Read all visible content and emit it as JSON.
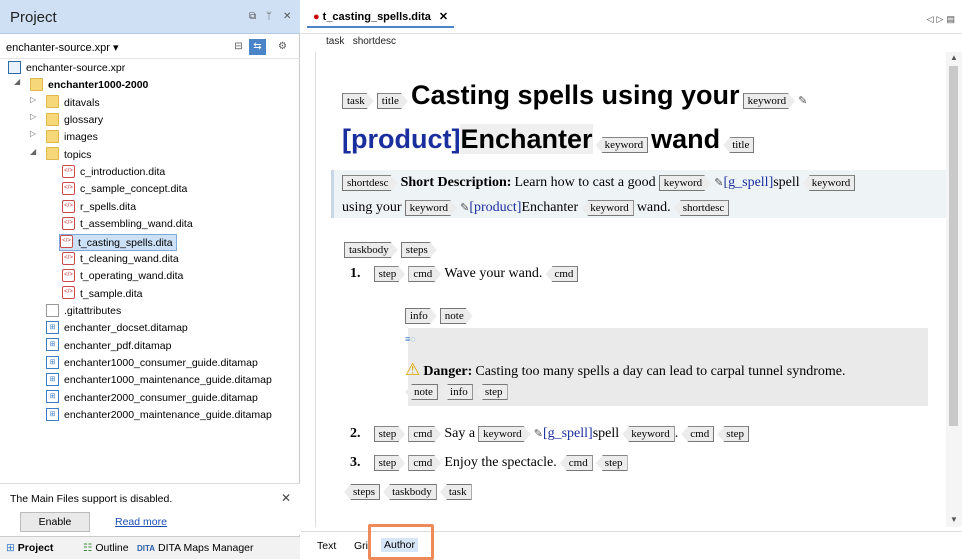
{
  "left_panel": {
    "title": "Project",
    "header_icons": [
      "restore-icon",
      "pin-icon",
      "close-icon"
    ],
    "project_selector": "enchanter-source.xpr ▾",
    "tree": [
      {
        "label": "enchanter-source.xpr",
        "type": "project",
        "level": 0
      },
      {
        "label": "enchanter1000-2000",
        "type": "folder",
        "level": 0,
        "expanded": true,
        "bold": true
      },
      {
        "label": "ditavals",
        "type": "folder",
        "level": 1
      },
      {
        "label": "glossary",
        "type": "folder",
        "level": 1
      },
      {
        "label": "images",
        "type": "folder",
        "level": 1
      },
      {
        "label": "topics",
        "type": "folder",
        "level": 1,
        "expanded": true
      },
      {
        "label": "c_introduction.dita",
        "type": "dita",
        "level": 2
      },
      {
        "label": "c_sample_concept.dita",
        "type": "dita",
        "level": 2
      },
      {
        "label": "r_spells.dita",
        "type": "dita",
        "level": 2
      },
      {
        "label": "t_assembling_wand.dita",
        "type": "dita",
        "level": 2
      },
      {
        "label": "t_casting_spells.dita",
        "type": "dita",
        "level": 2,
        "selected": true
      },
      {
        "label": "t_cleaning_wand.dita",
        "type": "dita",
        "level": 2
      },
      {
        "label": "t_operating_wand.dita",
        "type": "dita",
        "level": 2
      },
      {
        "label": "t_sample.dita",
        "type": "dita",
        "level": 2
      },
      {
        "label": ".gitattributes",
        "type": "file",
        "level": 1
      },
      {
        "label": "enchanter_docset.ditamap",
        "type": "map",
        "level": 1
      },
      {
        "label": "enchanter_pdf.ditamap",
        "type": "map",
        "level": 1
      },
      {
        "label": "enchanter1000_consumer_guide.ditamap",
        "type": "map",
        "level": 1
      },
      {
        "label": "enchanter1000_maintenance_guide.ditamap",
        "type": "map",
        "level": 1
      },
      {
        "label": "enchanter2000_consumer_guide.ditamap",
        "type": "map",
        "level": 1
      },
      {
        "label": "enchanter2000_maintenance_guide.ditamap",
        "type": "map",
        "level": 1
      }
    ],
    "notice": {
      "message": "The Main Files support is disabled.",
      "enable_label": "Enable",
      "read_more_label": "Read more"
    },
    "bottom_tabs": [
      "Project",
      "Outline",
      "DITA Maps Manager"
    ]
  },
  "editor": {
    "tab_label": "t_casting_spells.dita",
    "breadcrumb": [
      "task",
      "shortdesc"
    ],
    "bottom_tabs": [
      "Text",
      "Grid",
      "Author"
    ],
    "active_mode": "Author",
    "content": {
      "title_part1": "Casting spells using your",
      "title_product": "[product]",
      "title_part2": "Enchanter",
      "title_wand": "wand",
      "shortdesc_label": "Short Description:",
      "shortdesc_text1": "Learn how to cast a good",
      "shortdesc_gspell": "[g_spell]",
      "shortdesc_spell": "spell",
      "shortdesc_using": "using your",
      "shortdesc_product": "[product]",
      "shortdesc_enchanter": "Enchanter",
      "shortdesc_wand": "wand.",
      "step1_num": "1.",
      "step1_text": "Wave your wand.",
      "danger_label": "Danger:",
      "danger_text": "Casting too many spells a day can lead to carpal tunnel syndrome.",
      "step2_num": "2.",
      "step2_say": "Say a",
      "step2_gspell": "[g_spell]",
      "step2_spell": "spell",
      "step2_period": ".",
      "step3_num": "3.",
      "step3_text": "Enjoy the spectacle."
    },
    "tags": {
      "task": "task",
      "title": "title",
      "keyword": "keyword",
      "shortdesc": "shortdesc",
      "taskbody": "taskbody",
      "steps": "steps",
      "step": "step",
      "cmd": "cmd",
      "info": "info",
      "note": "note"
    }
  }
}
